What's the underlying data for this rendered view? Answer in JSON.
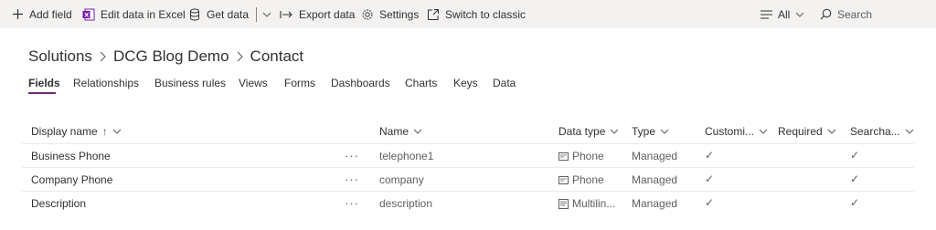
{
  "commandbar": {
    "add_field": "Add field",
    "edit_excel": "Edit data in Excel",
    "get_data": "Get data",
    "export_data": "Export data",
    "settings": "Settings",
    "switch_classic": "Switch to classic",
    "filter": "All",
    "search_placeholder": "Search"
  },
  "breadcrumb": {
    "root": "Solutions",
    "solution": "DCG Blog Demo",
    "entity": "Contact"
  },
  "tabs": [
    {
      "label": "Fields",
      "active": true
    },
    {
      "label": "Relationships"
    },
    {
      "label": "Business rules"
    },
    {
      "label": "Views"
    },
    {
      "label": "Forms"
    },
    {
      "label": "Dashboards"
    },
    {
      "label": "Charts"
    },
    {
      "label": "Keys"
    },
    {
      "label": "Data"
    }
  ],
  "table": {
    "columns": {
      "display_name": "Display name",
      "sort_indicator": "↑",
      "name": "Name",
      "data_type": "Data type",
      "type": "Type",
      "customizable": "Customi...",
      "required": "Required",
      "searchable": "Searcha..."
    },
    "rows": [
      {
        "display_name": "Business Phone",
        "more": "···",
        "name": "telephone1",
        "data_type": "Phone",
        "type": "Managed",
        "customizable": "✓",
        "required": "",
        "searchable": "✓"
      },
      {
        "display_name": "Company Phone",
        "more": "···",
        "name": "company",
        "data_type": "Phone",
        "type": "Managed",
        "customizable": "✓",
        "required": "",
        "searchable": "✓"
      },
      {
        "display_name": "Description",
        "more": "···",
        "name": "description",
        "data_type": "Multilin...",
        "type": "Managed",
        "customizable": "✓",
        "required": "",
        "searchable": "✓"
      }
    ]
  },
  "colors": {
    "accent": "#742774",
    "excel_icon": "#7719aa",
    "commandbar_bg": "#f3f2f1"
  }
}
